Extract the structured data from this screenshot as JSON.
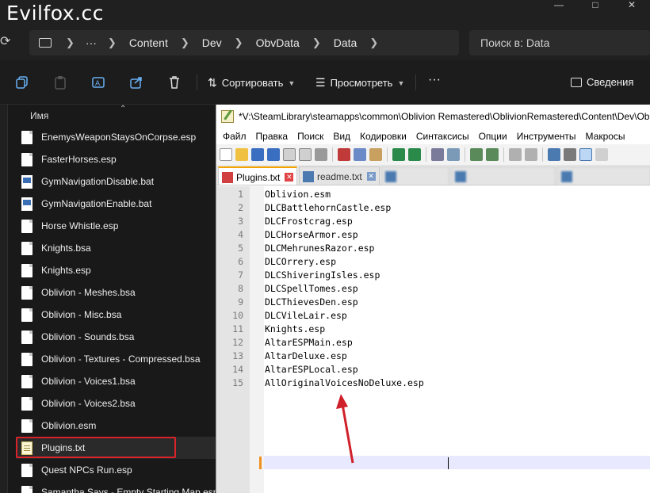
{
  "watermark": "Evilfox.cc",
  "address": {
    "crumbs": [
      "Content",
      "Dev",
      "ObvData",
      "Data"
    ],
    "ellipsis": "···"
  },
  "search": {
    "placeholder": "Поиск в: Data"
  },
  "toolbar": {
    "sort_label": "Сортировать",
    "view_label": "Просмотреть",
    "more_label": "···",
    "details_label": "Сведения"
  },
  "filelist": {
    "column_name": "Имя",
    "files": [
      {
        "name": "EnemysWeaponStaysOnCorpse.esp",
        "icon": "doc"
      },
      {
        "name": "FasterHorses.esp",
        "icon": "doc"
      },
      {
        "name": "GymNavigationDisable.bat",
        "icon": "bat"
      },
      {
        "name": "GymNavigationEnable.bat",
        "icon": "bat"
      },
      {
        "name": "Horse Whistle.esp",
        "icon": "doc"
      },
      {
        "name": "Knights.bsa",
        "icon": "doc"
      },
      {
        "name": "Knights.esp",
        "icon": "doc"
      },
      {
        "name": "Oblivion - Meshes.bsa",
        "icon": "doc"
      },
      {
        "name": "Oblivion - Misc.bsa",
        "icon": "doc"
      },
      {
        "name": "Oblivion - Sounds.bsa",
        "icon": "doc"
      },
      {
        "name": "Oblivion - Textures - Compressed.bsa",
        "icon": "doc"
      },
      {
        "name": "Oblivion - Voices1.bsa",
        "icon": "doc"
      },
      {
        "name": "Oblivion - Voices2.bsa",
        "icon": "doc"
      },
      {
        "name": "Oblivion.esm",
        "icon": "doc"
      },
      {
        "name": "Plugins.txt",
        "icon": "txt"
      },
      {
        "name": "Quest NPCs Run.esp",
        "icon": "doc"
      },
      {
        "name": "Samantha Says - Empty Starting Map.esp",
        "icon": "doc"
      }
    ]
  },
  "npp": {
    "title": "*V:\\SteamLibrary\\steamapps\\common\\Oblivion Remastered\\OblivionRemastered\\Content\\Dev\\Ob",
    "menu": [
      "Файл",
      "Правка",
      "Поиск",
      "Вид",
      "Кодировки",
      "Синтаксисы",
      "Опции",
      "Инструменты",
      "Макросы"
    ],
    "tabs": [
      {
        "label": "Plugins.txt",
        "active": true
      },
      {
        "label": "readme.txt",
        "active": false
      }
    ],
    "lines": [
      "Oblivion.esm",
      "DLCBattlehornCastle.esp",
      "DLCFrostcrag.esp",
      "DLCHorseArmor.esp",
      "DLCMehrunesRazor.esp",
      "DLCOrrery.esp",
      "DLCShiveringIsles.esp",
      "DLCSpellTomes.esp",
      "DLCThievesDen.esp",
      "DLCVileLair.esp",
      "Knights.esp",
      "AltarESPMain.esp",
      "AltarDeluxe.esp",
      "AltarESPLocal.esp",
      "AllOriginalVoicesNoDeluxe.esp"
    ],
    "line_numbers": [
      "1",
      "2",
      "3",
      "4",
      "5",
      "6",
      "7",
      "8",
      "9",
      "10",
      "11",
      "12",
      "13",
      "14",
      "15"
    ]
  },
  "colors": {
    "highlight_box": "#d9232a",
    "arrow": "#d0202a",
    "active_tab_accent": "#f3a200"
  }
}
